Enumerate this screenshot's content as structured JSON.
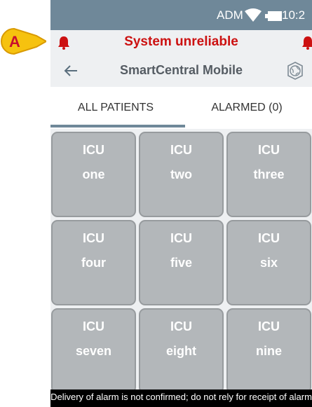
{
  "annotation": {
    "label": "A"
  },
  "status_bar": {
    "carrier": "ADM",
    "time": "10:2"
  },
  "warning": {
    "text": "System unreliable"
  },
  "app_header": {
    "title": "SmartCentral Mobile"
  },
  "tabs": [
    {
      "label": "ALL PATIENTS",
      "selected": true
    },
    {
      "label": "ALARMED (0)",
      "selected": false
    }
  ],
  "beds": [
    {
      "unit": "ICU",
      "name": "one"
    },
    {
      "unit": "ICU",
      "name": "two"
    },
    {
      "unit": "ICU",
      "name": "three"
    },
    {
      "unit": "ICU",
      "name": "four"
    },
    {
      "unit": "ICU",
      "name": "five"
    },
    {
      "unit": "ICU",
      "name": "six"
    },
    {
      "unit": "ICU",
      "name": "seven"
    },
    {
      "unit": "ICU",
      "name": "eight"
    },
    {
      "unit": "ICU",
      "name": "nine"
    }
  ],
  "footer": {
    "text": "Delivery of alarm is not confirmed; do not rely for receipt of alarm"
  },
  "colors": {
    "status_bar": "#6f8899",
    "warning_text": "#cc1111",
    "tile_bg": "#b3b7ba",
    "callout_fill": "#f6c20f",
    "callout_text": "#c8102e"
  }
}
